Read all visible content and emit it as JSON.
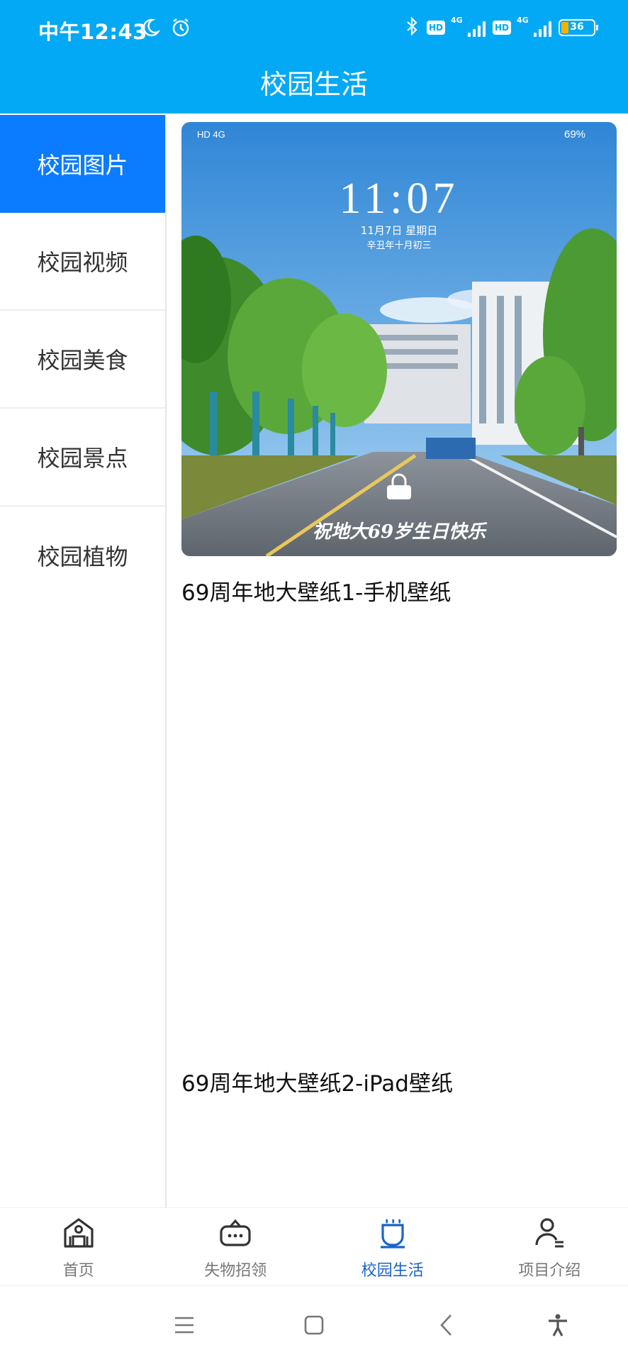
{
  "status_bar": {
    "time": "中午12:43",
    "hd_1": "HD",
    "hd_2": "HD",
    "net_1": "4G",
    "net_2": "4G",
    "battery": "36"
  },
  "nav": {
    "title": "校园生活"
  },
  "sidebar": {
    "items": [
      {
        "label": "校园图片",
        "active": true
      },
      {
        "label": "校园视频"
      },
      {
        "label": "校园美食"
      },
      {
        "label": "校园景点"
      },
      {
        "label": "校园植物"
      }
    ]
  },
  "content": {
    "cards": [
      {
        "title": "69周年地大壁纸1-手机壁纸",
        "image": {
          "lock_time": "11:07",
          "lock_date": "11月7日   星期日",
          "lunar": "辛丑年十月初三",
          "battery": "69%",
          "caption": "祝地大69岁生日快乐"
        }
      },
      {
        "title": "69周年地大壁纸2-iPad壁纸"
      }
    ]
  },
  "tabbar": {
    "items": [
      {
        "label": "首页",
        "icon": "home-building-icon"
      },
      {
        "label": "失物招领",
        "icon": "lost-found-icon"
      },
      {
        "label": "校园生活",
        "icon": "cup-icon",
        "active": true
      },
      {
        "label": "项目介绍",
        "icon": "person-icon"
      }
    ]
  },
  "colors": {
    "header": "#03a9f4",
    "active_sidebar": "#0b7bff",
    "active_tab": "#1a64c8"
  }
}
